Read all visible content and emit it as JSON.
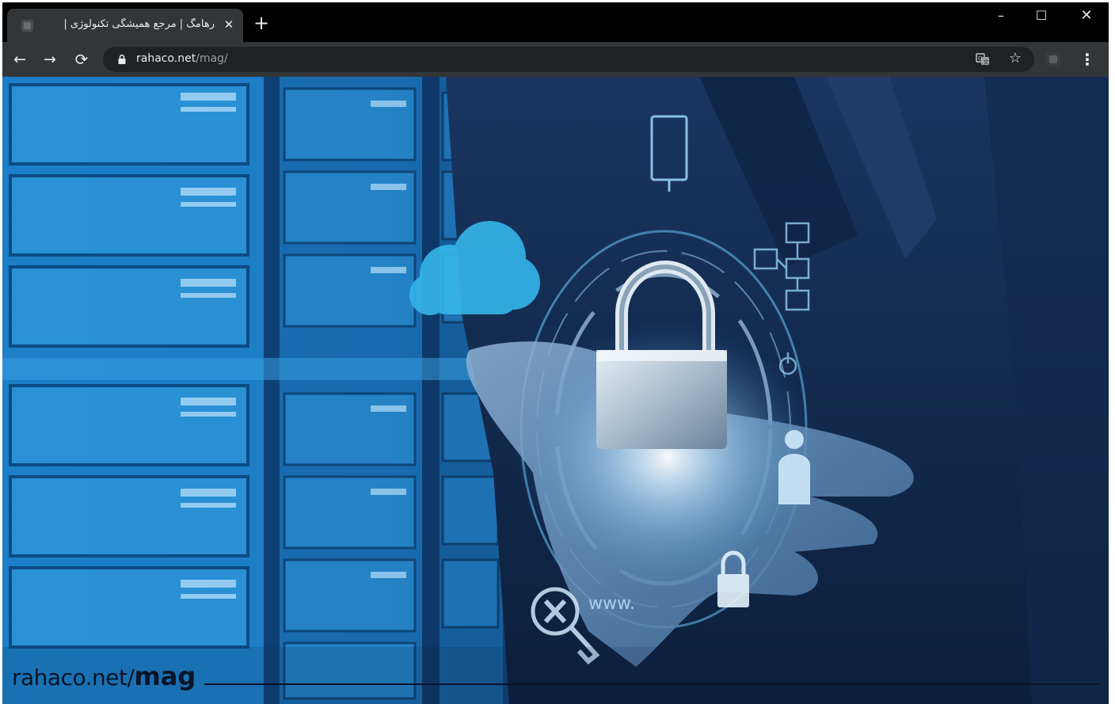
{
  "browser": {
    "tab": {
      "title": "رهامگ | مرجع همیشگی تکنولوژی |",
      "close_icon": "close-icon",
      "favicon": "site-favicon"
    },
    "new_tab_label": "+",
    "window_controls": {
      "minimize": "–",
      "maximize": "☐",
      "close": "✕"
    },
    "nav": {
      "back": "←",
      "forward": "→",
      "reload": "⟳"
    },
    "address": {
      "domain": "rahaco.net",
      "path": "/mag/"
    },
    "toolbar_icons": [
      "lock-icon",
      "translate-icon",
      "star-icon",
      "extension-icon",
      "menu-icon"
    ],
    "star": "☆",
    "menu": "⋮"
  },
  "page": {
    "caption": {
      "domain": "rahaco.net/",
      "mag": "mag"
    },
    "hero_image": "cyber-security-padlock-hand-datacenter",
    "colors": {
      "background": "#0f2c5c",
      "accent": "#1e9be0",
      "glow": "#bfe6ff"
    }
  }
}
